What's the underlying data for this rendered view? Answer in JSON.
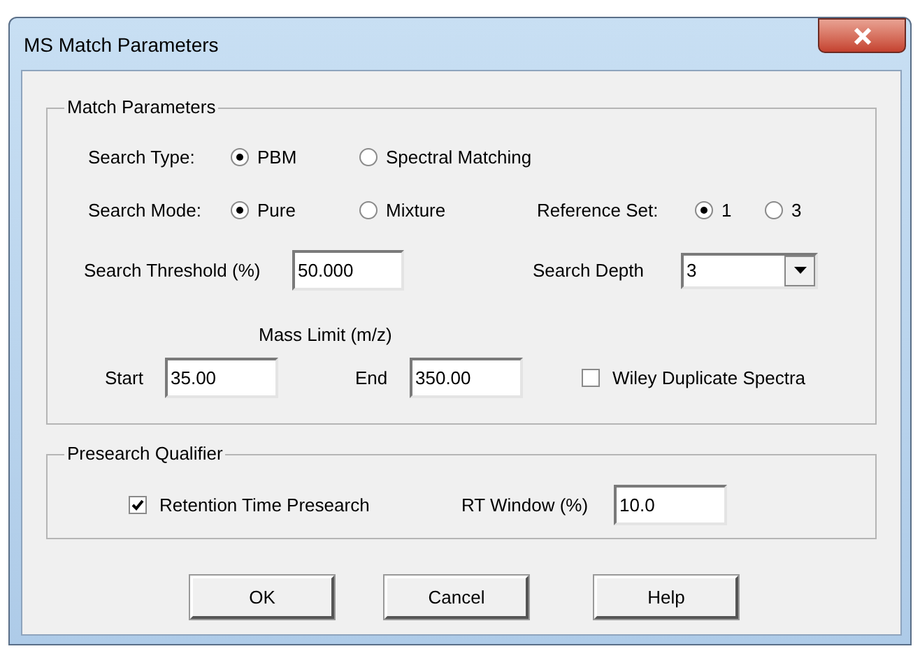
{
  "window": {
    "title": "MS Match Parameters"
  },
  "match_parameters": {
    "title": "Match Parameters",
    "search_type": {
      "label": "Search Type:",
      "options": [
        {
          "label": "PBM",
          "selected": true
        },
        {
          "label": "Spectral Matching",
          "selected": false
        }
      ]
    },
    "search_mode": {
      "label": "Search Mode:",
      "options": [
        {
          "label": "Pure",
          "selected": true
        },
        {
          "label": "Mixture",
          "selected": false
        }
      ]
    },
    "reference_set": {
      "label": "Reference Set:",
      "options": [
        {
          "label": "1",
          "selected": true
        },
        {
          "label": "3",
          "selected": false
        }
      ]
    },
    "search_threshold": {
      "label": "Search Threshold (%)",
      "value": "50.000"
    },
    "search_depth": {
      "label": "Search Depth",
      "value": "3"
    },
    "mass_limit": {
      "label": "Mass Limit (m/z)",
      "start": {
        "label": "Start",
        "value": "35.00"
      },
      "end": {
        "label": "End",
        "value": "350.00"
      }
    },
    "wiley_duplicate_spectra": {
      "label": "Wiley Duplicate Spectra",
      "checked": false
    }
  },
  "presearch_qualifier": {
    "title": "Presearch Qualifier",
    "retention_time_presearch": {
      "label": "Retention Time Presearch",
      "checked": true
    },
    "rt_window": {
      "label": "RT Window (%)",
      "value": "10.0"
    }
  },
  "buttons": [
    {
      "label": "OK"
    },
    {
      "label": "Cancel"
    },
    {
      "label": "Help"
    }
  ]
}
